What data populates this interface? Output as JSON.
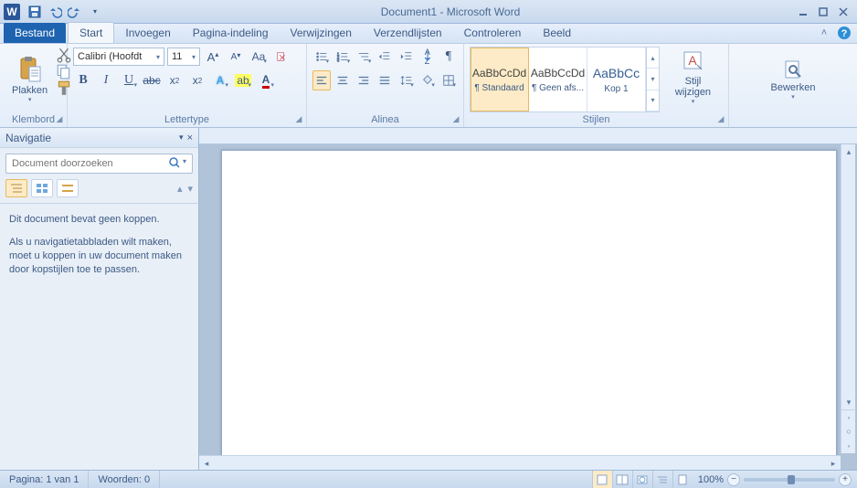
{
  "title": "Document1 - Microsoft Word",
  "tabs": {
    "file": "Bestand",
    "home": "Start",
    "insert": "Invoegen",
    "layout": "Pagina-indeling",
    "refs": "Verwijzingen",
    "mail": "Verzendlijsten",
    "review": "Controleren",
    "view": "Beeld"
  },
  "ribbon": {
    "clipboard": {
      "label": "Klembord",
      "paste": "Plakken"
    },
    "font": {
      "label": "Lettertype",
      "name": "Calibri (Hoofdt",
      "size": "11"
    },
    "paragraph": {
      "label": "Alinea"
    },
    "styles": {
      "label": "Stijlen",
      "items": [
        {
          "preview": "AaBbCcDd",
          "name": "¶ Standaard"
        },
        {
          "preview": "AaBbCcDd",
          "name": "¶ Geen afs..."
        },
        {
          "preview": "AaBbCc",
          "name": "Kop 1"
        }
      ],
      "change": "Stijl wijzigen"
    },
    "editing": {
      "label": "Bewerken"
    }
  },
  "nav": {
    "title": "Navigatie",
    "search_placeholder": "Document doorzoeken",
    "msg1": "Dit document bevat geen koppen.",
    "msg2": "Als u navigatietabbladen wilt maken, moet u koppen in uw document maken door kopstijlen toe te passen."
  },
  "status": {
    "page": "Pagina: 1 van 1",
    "words": "Woorden: 0",
    "zoom": "100%"
  }
}
